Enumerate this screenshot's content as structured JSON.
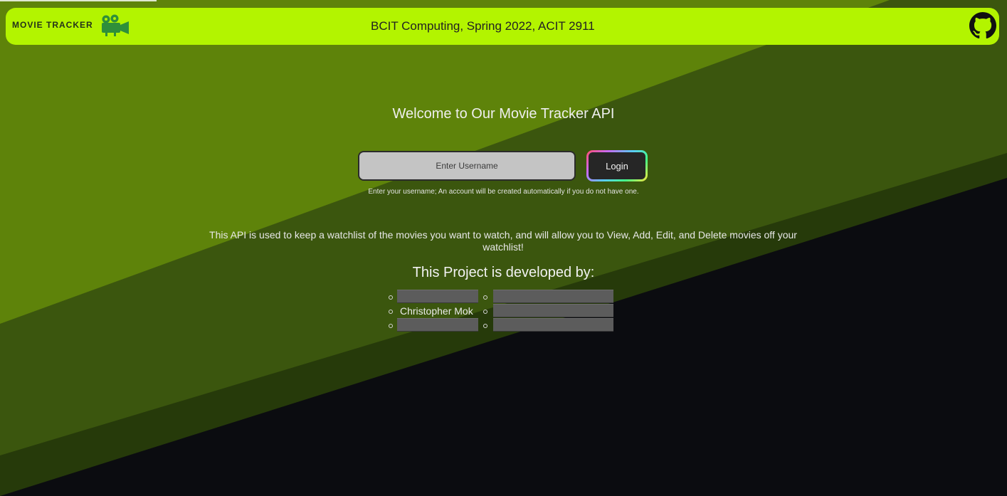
{
  "colors": {
    "nav_bg": "#b3f400",
    "bg_light_green": "#5e830a",
    "bg_dark_green": "#3b560e",
    "bg_stripe": "#263a0a",
    "bg_dark": "#0b0c10",
    "redaction": "#5c5c5c"
  },
  "nav": {
    "brand": "MOVIE TRACKER",
    "brand_icon": "movie-camera-icon",
    "title": "BCIT Computing, Spring 2022, ACIT 2911",
    "repo_icon": "github-icon"
  },
  "main": {
    "welcome": "Welcome to Our Movie Tracker API",
    "username_placeholder": "Enter Username",
    "login_label": "Login",
    "hint": "Enter your username; An account will be created automatically if you do not have one.",
    "description": "This API is used to keep a watchlist of the movies you want to watch, and will allow you to View, Add, Edit, and Delete movies off your watchlist!",
    "developers_title": "This Project is developed by:",
    "developers_col1": [
      "",
      "Christopher Mok",
      ""
    ],
    "developers_col2": [
      "",
      "",
      ""
    ]
  }
}
